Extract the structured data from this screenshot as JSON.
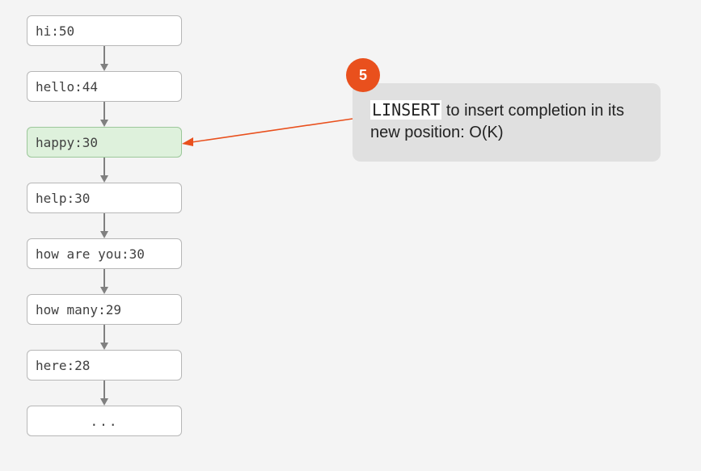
{
  "list": {
    "nodes": [
      {
        "label": "hi:50",
        "highlight": false
      },
      {
        "label": "hello:44",
        "highlight": false
      },
      {
        "label": "happy:30",
        "highlight": true
      },
      {
        "label": "help:30",
        "highlight": false
      },
      {
        "label": "how are you:30",
        "highlight": false
      },
      {
        "label": "how many:29",
        "highlight": false
      },
      {
        "label": "here:28",
        "highlight": false
      }
    ],
    "ellipsis": "..."
  },
  "callout": {
    "step": "5",
    "command": "LINSERT",
    "text": " to insert completion in its new position: O(K)"
  }
}
